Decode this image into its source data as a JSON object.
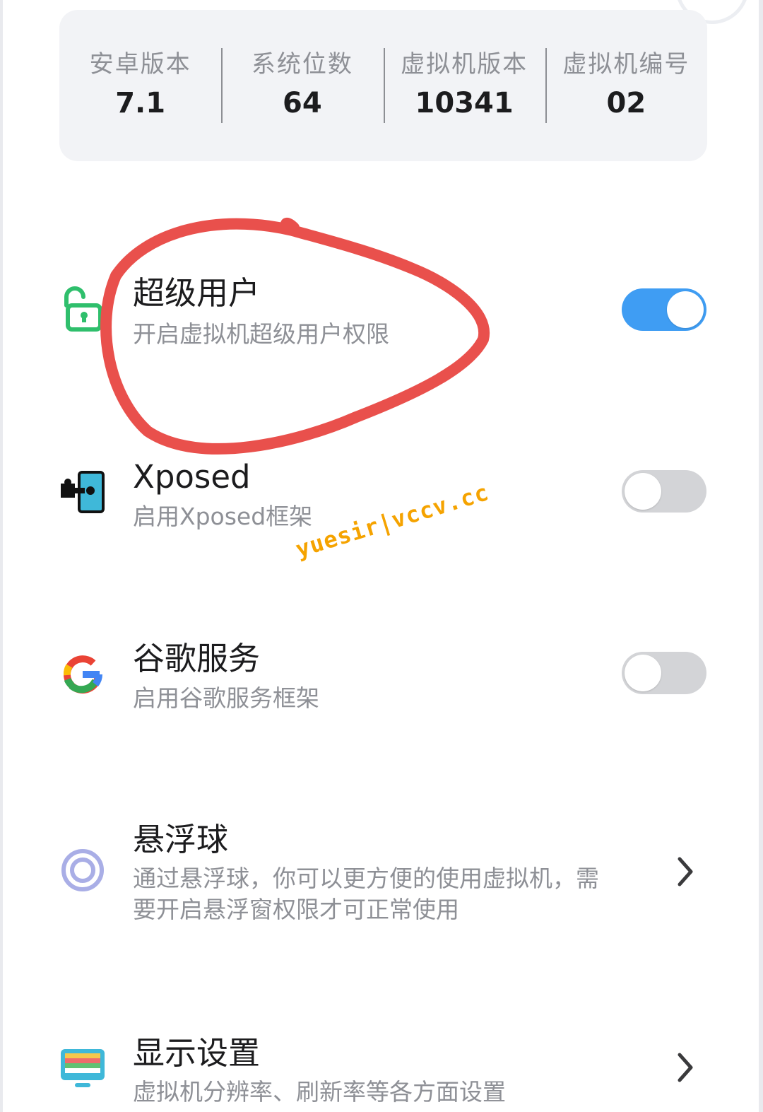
{
  "info": {
    "stats": [
      {
        "label": "安卓版本",
        "value": "7.1"
      },
      {
        "label": "系统位数",
        "value": "64"
      },
      {
        "label": "虚拟机版本",
        "value": "10341"
      },
      {
        "label": "虚拟机编号",
        "value": "02"
      }
    ]
  },
  "settings": {
    "superuser": {
      "title": "超级用户",
      "subtitle": "开启虚拟机超级用户权限",
      "enabled": true,
      "icon": "unlock-icon"
    },
    "xposed": {
      "title": "Xposed",
      "subtitle": "启用Xposed框架",
      "enabled": false,
      "icon": "xposed-puzzle-icon"
    },
    "google": {
      "title": "谷歌服务",
      "subtitle": "启用谷歌服务框架",
      "enabled": false,
      "icon": "google-g-icon"
    },
    "float_ball": {
      "title": "悬浮球",
      "subtitle_line1": "通过悬浮球，你可以更方便的使用虚拟机，需",
      "subtitle_line2": "要开启悬浮窗权限才可正常使用",
      "icon": "float-ball-icon"
    },
    "display": {
      "title": "显示设置",
      "subtitle": "虚拟机分辨率、刷新率等各方面设置",
      "icon": "display-monitor-icon"
    }
  },
  "watermark": "yuesir|vccv.cc",
  "colors": {
    "accent": "#3f9df3",
    "toggle_off": "#d3d4d7",
    "annotation": "#e9504c",
    "watermark": "#f5a300"
  }
}
